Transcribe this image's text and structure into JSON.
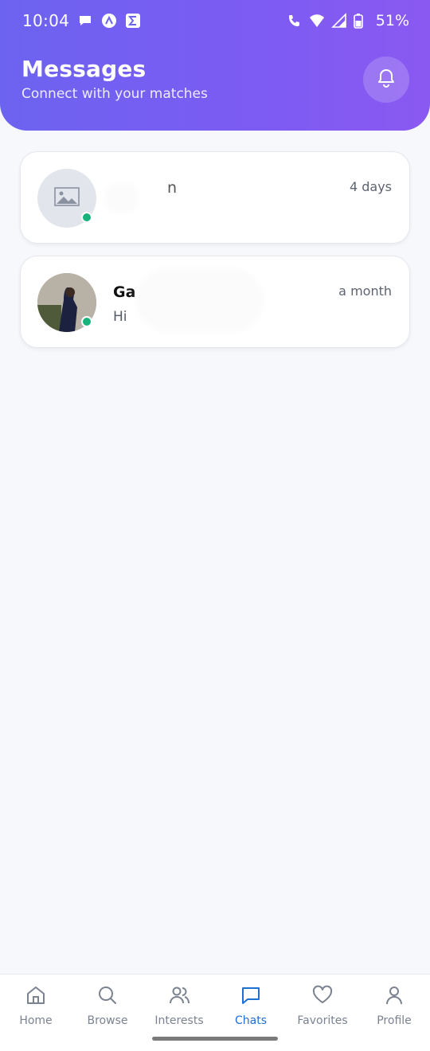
{
  "statusbar": {
    "time": "10:04",
    "battery": "51%",
    "left_icons": [
      "chat-bubble-icon",
      "triangle-a-icon",
      "sigma-icon"
    ],
    "right_icons": [
      "wifi-call-icon",
      "wifi-icon",
      "signal-icon",
      "battery-icon"
    ]
  },
  "header": {
    "title": "Messages",
    "subtitle": "Connect with your matches",
    "bell_icon": "bell-icon",
    "gradient_start": "#6c63f0",
    "gradient_end": "#8a59f2"
  },
  "chats": [
    {
      "name": "n",
      "preview": "",
      "time": "4 days",
      "online": true,
      "avatar": "image-placeholder-icon"
    },
    {
      "name": "Ga",
      "preview": "Hi",
      "time": "a month",
      "online": true,
      "avatar": "profile-photo"
    }
  ],
  "nav": {
    "active": "Chats",
    "active_color": "#1d6fd1",
    "items": [
      {
        "label": "Home",
        "icon": "home-icon"
      },
      {
        "label": "Browse",
        "icon": "search-icon"
      },
      {
        "label": "Interests",
        "icon": "users-icon"
      },
      {
        "label": "Chats",
        "icon": "chat-icon"
      },
      {
        "label": "Favorites",
        "icon": "heart-icon"
      },
      {
        "label": "Profile",
        "icon": "user-icon"
      }
    ]
  }
}
